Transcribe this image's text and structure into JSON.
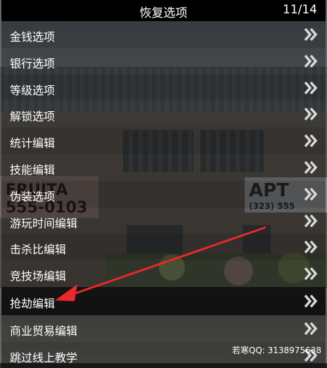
{
  "menu": {
    "title": "恢复选项",
    "counter": "11/14",
    "items": [
      {
        "label": "金钱选项"
      },
      {
        "label": "银行选项"
      },
      {
        "label": "等级选项"
      },
      {
        "label": "解锁选项"
      },
      {
        "label": "统计编辑"
      },
      {
        "label": "技能编辑"
      },
      {
        "label": "伪装选项"
      },
      {
        "label": "游玩时间编辑"
      },
      {
        "label": "击杀比编辑"
      },
      {
        "label": "竞技场编辑"
      },
      {
        "label": "抢劫编辑"
      },
      {
        "label": "商业贸易编辑"
      },
      {
        "label": "跳过线上教学"
      }
    ],
    "selected_index": 10
  },
  "scene": {
    "sign_left": "FRUITA\n555-0103",
    "sign_right": "APT",
    "sign_right_sub": "(323) 555"
  },
  "watermark": "若寒QQ: 3138975638",
  "colors": {
    "arrow": "#e8282b",
    "text": "#ffffff",
    "header_bg": "#000000"
  },
  "icons": {
    "item_chevron": "double-chevron-right-icon"
  }
}
